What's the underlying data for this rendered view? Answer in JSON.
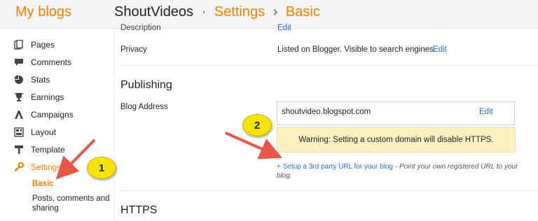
{
  "header": {
    "brand": "My blogs",
    "blog_name": "ShoutVideos",
    "separator": "·",
    "section": "Settings",
    "arrow": "›",
    "page": "Basic"
  },
  "sidebar": {
    "items": [
      {
        "label": "Pages",
        "icon": "pages-icon"
      },
      {
        "label": "Comments",
        "icon": "comments-icon"
      },
      {
        "label": "Stats",
        "icon": "stats-icon"
      },
      {
        "label": "Earnings",
        "icon": "earnings-icon"
      },
      {
        "label": "Campaigns",
        "icon": "campaigns-icon"
      },
      {
        "label": "Layout",
        "icon": "layout-icon"
      },
      {
        "label": "Template",
        "icon": "template-icon"
      },
      {
        "label": "Settings",
        "icon": "settings-icon"
      }
    ],
    "sub_items": [
      {
        "label": "Basic"
      },
      {
        "label": "Posts, comments and sharing"
      }
    ]
  },
  "main": {
    "cut_label": "Description",
    "cut_edit": "Edit",
    "privacy": {
      "label": "Privacy",
      "value": "Listed on Blogger. Visible to search engines.",
      "edit": "Edit"
    },
    "publishing": {
      "title": "Publishing",
      "blog_address_label": "Blog Address",
      "address": "shoutvideo.blogspot.com",
      "edit": "Edit",
      "warning": "Warning: Setting a custom domain will disable HTTPS.",
      "setup_link": "+ Setup a 3rd party URL for your blog",
      "setup_desc": " - Point your own registered URL to your blog."
    },
    "https": {
      "title": "HTTPS"
    }
  },
  "annotations": {
    "bubble_1": "1",
    "bubble_2": "2",
    "bubble_color": "#f7e200",
    "arrow_color": "#e8564a"
  },
  "colors": {
    "accent": "#f57d00",
    "link": "#2a6ed6",
    "warning_bg": "#fdf1c4"
  }
}
